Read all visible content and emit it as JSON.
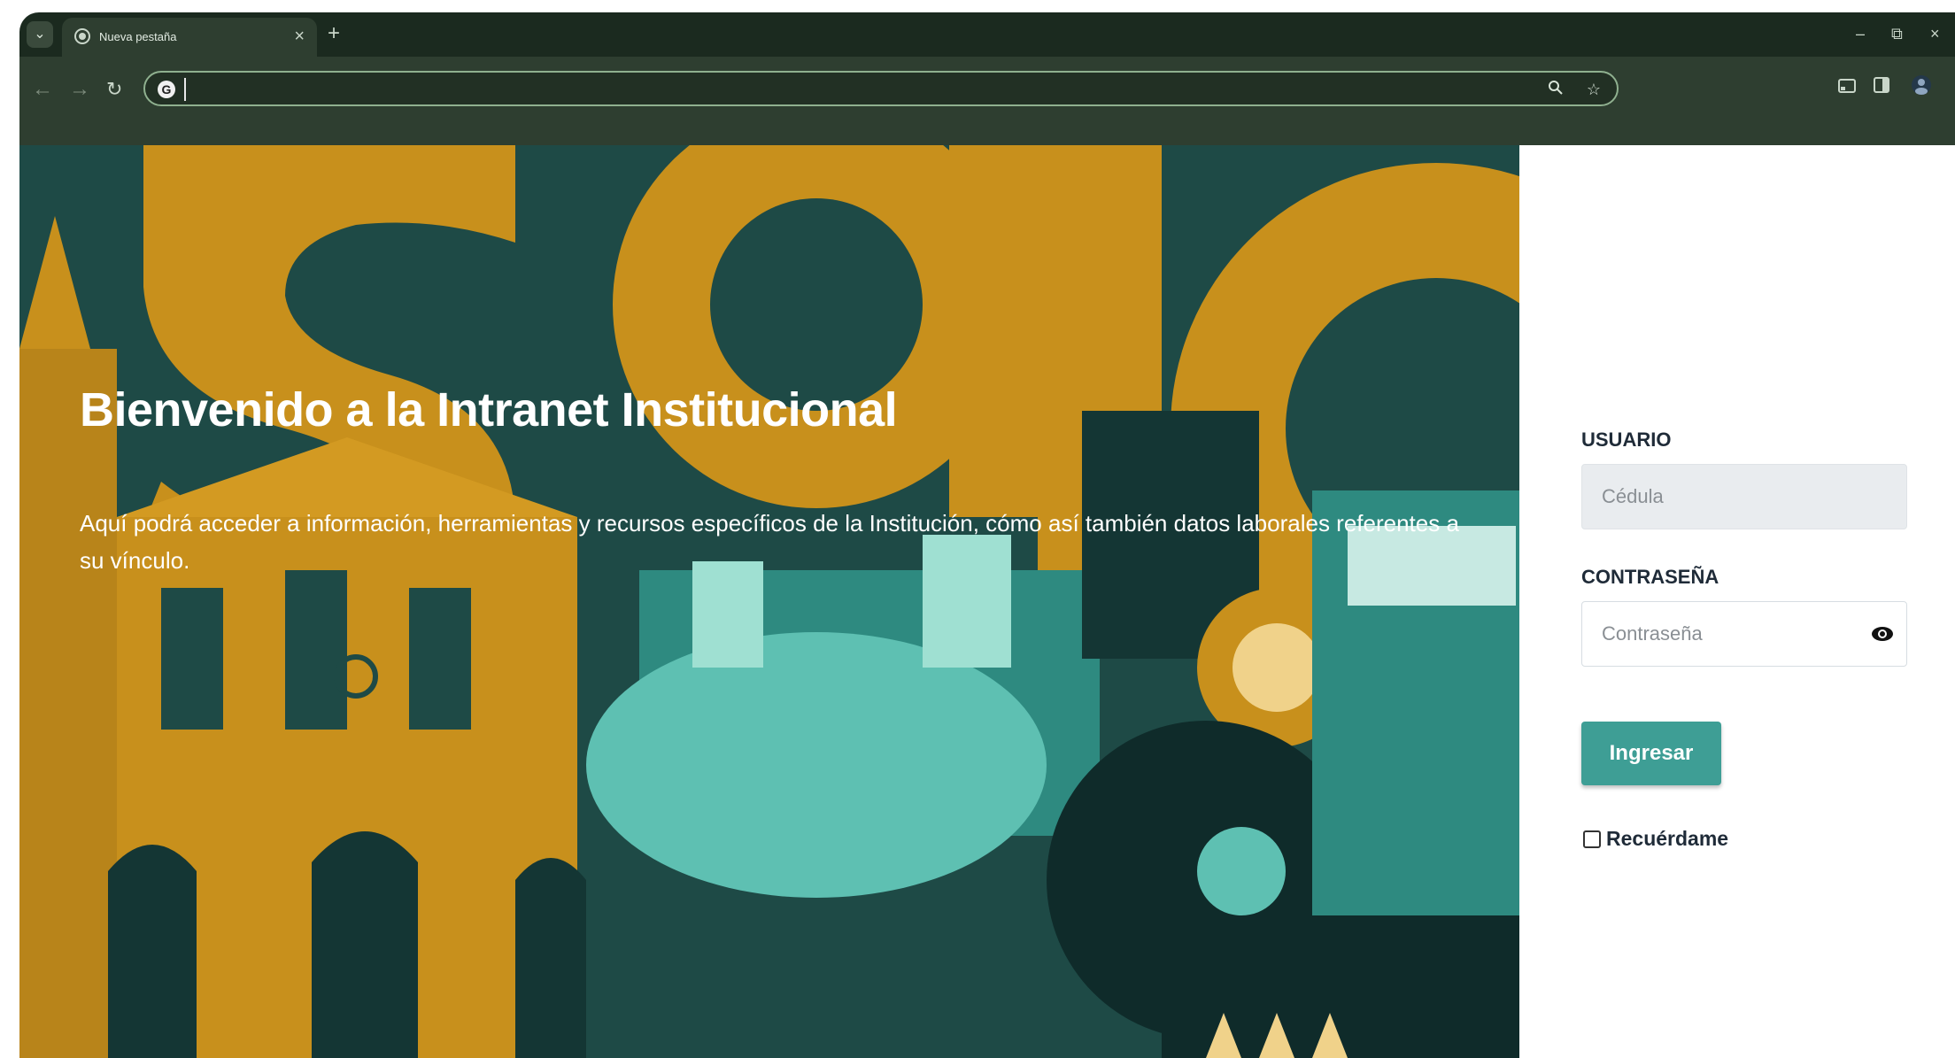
{
  "browser": {
    "tab_title": "Nueva pestaña",
    "tab_close": "×",
    "new_tab": "+",
    "omnibox_value": "",
    "minimize": "–",
    "restore": "⧉",
    "close": "×",
    "icons": [
      "tab-search-icon",
      "favicon-icon",
      "back-icon",
      "forward-icon",
      "reload-icon",
      "google-icon",
      "zoom-icon",
      "bookmark-star-icon",
      "cast-icon",
      "side-panel-icon",
      "profile-icon"
    ]
  },
  "hero": {
    "title": "Bienvenido a la Intranet Institucional",
    "description": "Aquí podrá acceder a información, herramientas y recursos específicos de la Institución, cómo así también datos laborales referentes a su vínculo."
  },
  "login": {
    "user_label": "USUARIO",
    "user_placeholder": "Cédula",
    "password_label": "CONTRASEÑA",
    "password_placeholder": "Contraseña",
    "submit_label": "Ingresar",
    "remember_label": "Recuérdame",
    "remember_checked": false
  },
  "colors": {
    "chrome_dark": "#1b2a1f",
    "chrome_toolbar": "#2e3e30",
    "hero_teal": "#1e4a46",
    "hero_gold": "#c8901c",
    "button_teal": "#3e9e95"
  }
}
